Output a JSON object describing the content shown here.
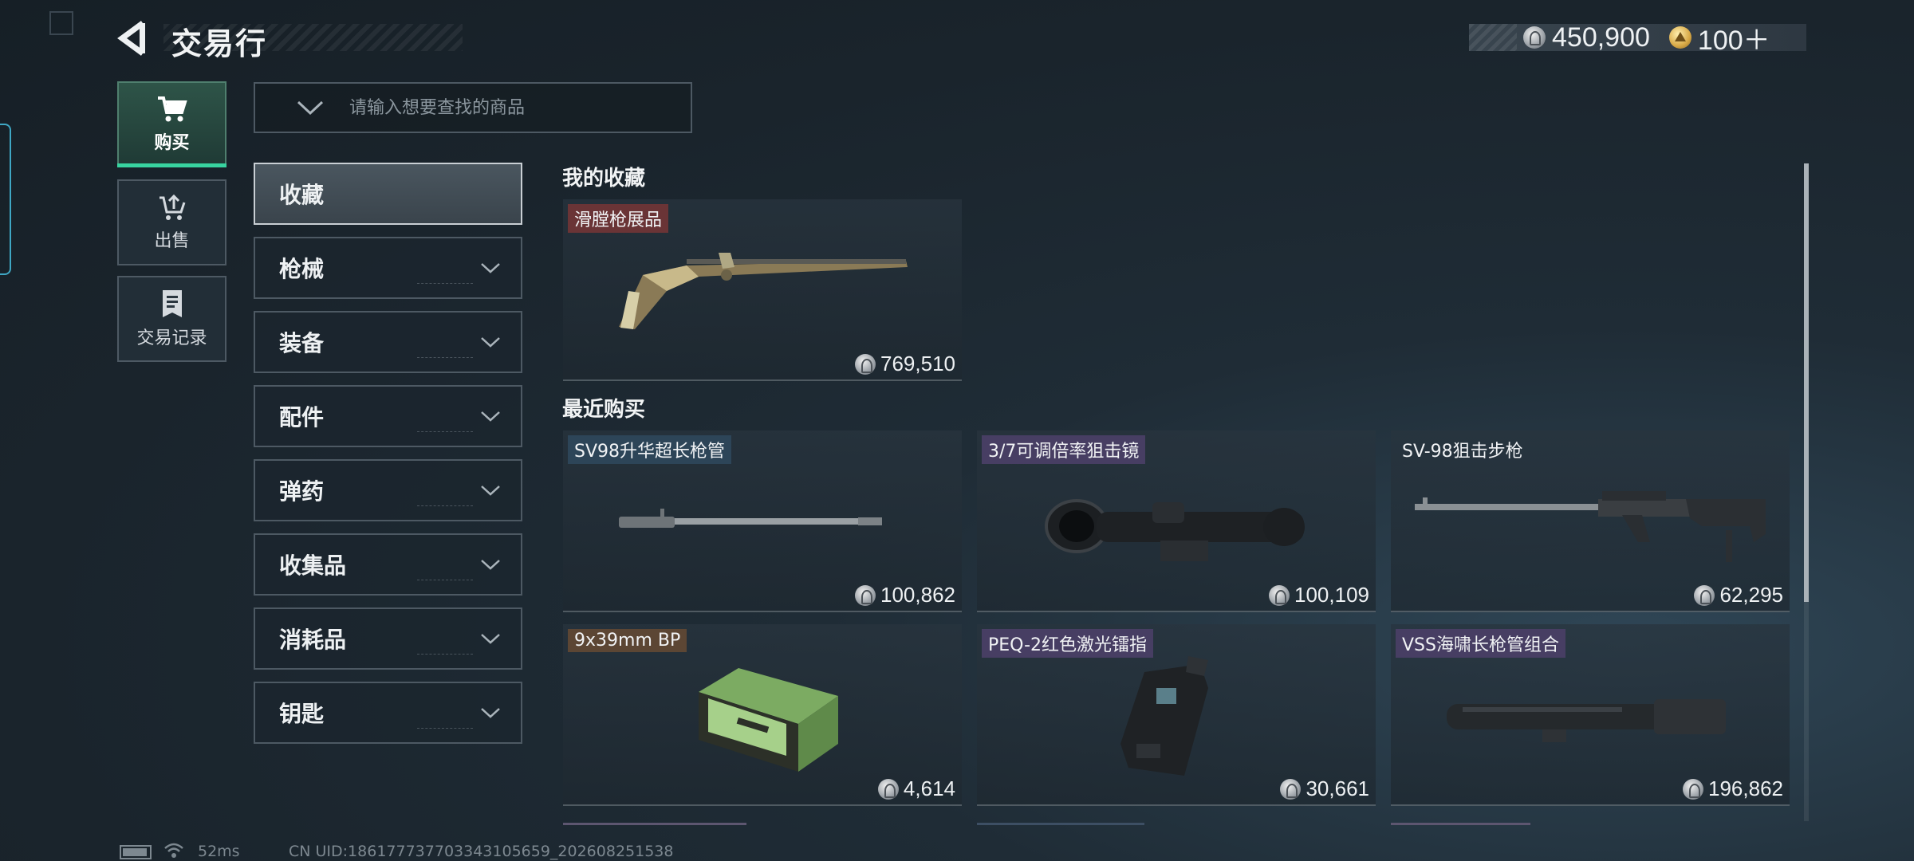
{
  "header": {
    "title": "交易行",
    "currency": [
      {
        "icon": "silver-coin-icon",
        "value": "450,900"
      },
      {
        "icon": "gold-coin-icon",
        "value": "100＋"
      }
    ]
  },
  "modes": [
    {
      "label": "购买",
      "icon": "cart-icon",
      "active": true
    },
    {
      "label": "出售",
      "icon": "sell-icon",
      "active": false
    },
    {
      "label": "交易记录",
      "icon": "record-icon",
      "active": false
    }
  ],
  "search": {
    "placeholder": "请输入想要查找的商品",
    "value": ""
  },
  "categories": [
    {
      "label": "收藏",
      "active": true
    },
    {
      "label": "枪械"
    },
    {
      "label": "装备"
    },
    {
      "label": "配件"
    },
    {
      "label": "弹药"
    },
    {
      "label": "收集品"
    },
    {
      "label": "消耗品"
    },
    {
      "label": "钥匙"
    }
  ],
  "favorites": {
    "heading": "我的收藏",
    "items": [
      {
        "name": "滑膛枪展品",
        "price": "769,510",
        "tag_color": "#6a3436"
      }
    ]
  },
  "recent": {
    "heading": "最近购买",
    "items": [
      {
        "name": "SV98升华超长枪管",
        "price": "100,862",
        "tag_color": "#2d4558"
      },
      {
        "name": "3/7可调倍率狙击镜",
        "price": "100,109",
        "tag_color": "#473e63"
      },
      {
        "name": "SV-98狙击步枪",
        "price": "62,295",
        "tag_color": "transparent"
      },
      {
        "name": "9x39mm BP",
        "price": "4,614",
        "tag_color": "#5c4634"
      },
      {
        "name": "PEQ-2红色激光镭指",
        "price": "30,661",
        "tag_color": "#473e63"
      },
      {
        "name": "VSS海啸长枪管组合",
        "price": "196,862",
        "tag_color": "#473e63"
      }
    ]
  },
  "status_bar": {
    "ping": "52ms",
    "uid": "CN UID:186177737703343105659_202608251538"
  },
  "colors": {
    "accent": "#38d4a0",
    "background": "#1a242c"
  }
}
